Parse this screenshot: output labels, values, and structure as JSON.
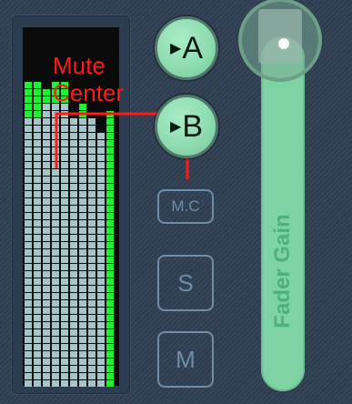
{
  "meter": {
    "columns": 10,
    "rows": 49,
    "levels": [
      0.75,
      0.75,
      0.8,
      0.8,
      0.8,
      0.75,
      0.75,
      0.75,
      0.72,
      0.0
    ],
    "peak_hold": [
      0.86,
      0.86,
      0.84,
      0.86,
      0.86,
      0.0,
      0.8,
      0.0,
      0.0,
      0.78
    ],
    "colors": {
      "body": "#a8c4c6",
      "peak": "#22ee33",
      "background": "#0a0a0a"
    }
  },
  "annotation": {
    "line1": "Mute",
    "line2": "Center",
    "color": "#ff1a1a"
  },
  "buttons": {
    "a_label": "A",
    "b_label": "B",
    "mc_label": "M.C",
    "s_label": "S",
    "m_label": "M",
    "arrow_icon": "play-arrow-icon"
  },
  "fader": {
    "label": "Fader Gain",
    "position": 1.0,
    "colors": {
      "track": "#7dd3a4",
      "label": "#4fb07f"
    }
  }
}
